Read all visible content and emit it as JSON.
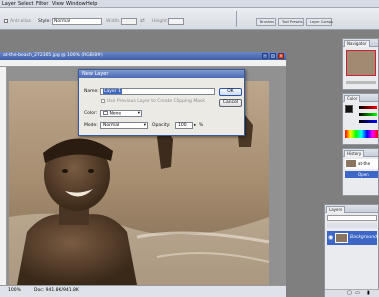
{
  "menubar": {
    "items": [
      "Layer",
      "Select",
      "Filter",
      "View",
      "Window",
      "Help"
    ]
  },
  "options": {
    "anti_alias": "Anti-alias",
    "style_label": "Style:",
    "style_value": "Normal",
    "width_label": "Width:",
    "height_label": "Height:"
  },
  "palette_well": {
    "tabs": [
      "Brushes",
      "Tool Presets",
      "Layer Comps"
    ]
  },
  "document": {
    "title": "at-the-beach_272305.jpg @ 100% (RGB/8#)",
    "status": "Doc: 941.8K/941.8K",
    "zoom": "100%"
  },
  "dialog": {
    "title": "New Layer",
    "name_label": "Name:",
    "name_value": "Layer 1",
    "clip_label": "Use Previous Layer to Create Clipping Mask",
    "color_label": "Color:",
    "color_value": "None",
    "mode_label": "Mode:",
    "mode_value": "Normal",
    "opacity_label": "Opacity:",
    "opacity_value": "100",
    "opacity_unit": "%",
    "ok": "OK",
    "cancel": "Cancel"
  },
  "panels": {
    "navigator_tab": "Navigator",
    "color_tab": "Color",
    "history_tab": "History",
    "history_item": "at-the",
    "history_open": "Open",
    "layers_tab": "Layers",
    "layer_name": "Background"
  },
  "colors": {
    "accent": "#3f5fa8",
    "panel_bg": "#e9ebef"
  }
}
